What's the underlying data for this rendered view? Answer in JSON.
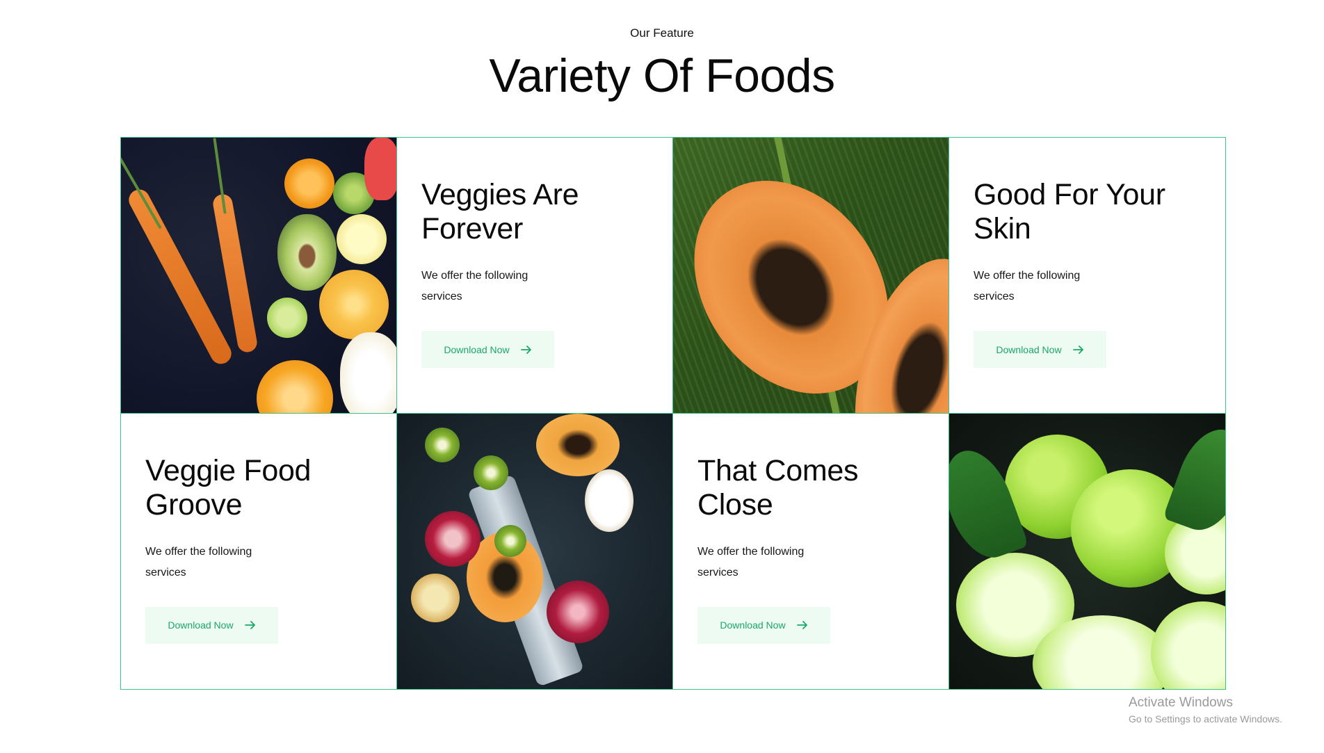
{
  "header": {
    "eyebrow": "Our Feature",
    "title": "Variety Of Foods"
  },
  "cards": [
    {
      "title": "Veggies Are Forever",
      "description": "We offer the following services",
      "button_label": "Download Now"
    },
    {
      "title": "Good For Your Skin",
      "description": "We offer the following services",
      "button_label": "Download Now"
    },
    {
      "title": "Veggie Food Groove",
      "description": "We offer the following services",
      "button_label": "Download Now"
    },
    {
      "title": "That Comes Close",
      "description": "We offer the following services",
      "button_label": "Download Now"
    }
  ],
  "images": [
    {
      "subject": "carrots-and-citrus-fruits"
    },
    {
      "subject": "papaya-on-banana-leaf"
    },
    {
      "subject": "cut-tropical-fruits-with-knife"
    },
    {
      "subject": "limes"
    }
  ],
  "colors": {
    "accent": "#1aa866",
    "grid_border": "#3ec48a",
    "button_bg": "#edfbf3"
  },
  "watermark": {
    "line1": "Activate Windows",
    "line2": "Go to Settings to activate Windows."
  }
}
